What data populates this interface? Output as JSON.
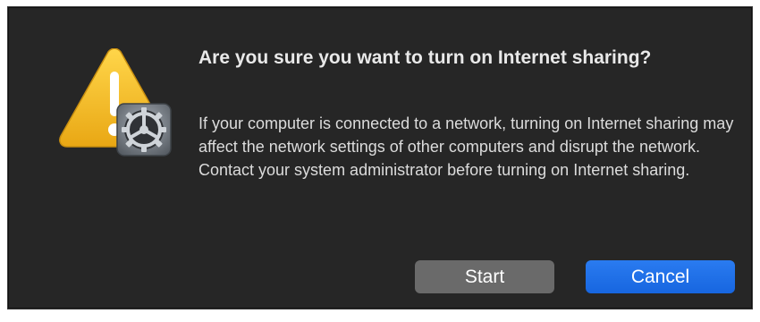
{
  "dialog": {
    "title": "Are you sure you want to turn on Internet sharing?",
    "message": "If your computer is connected to a network, turning on Internet sharing may affect the network settings of other computers and disrupt the network. Contact your system administrator before turning on Internet sharing.",
    "icon": "warning-triangle-with-system-preferences-gear-icon",
    "buttons": {
      "start_label": "Start",
      "cancel_label": "Cancel"
    }
  },
  "colors": {
    "background": "#262626",
    "primary_button": "#1f6fe8",
    "secondary_button": "#6a6a6a",
    "warning": "#f2c12e"
  }
}
